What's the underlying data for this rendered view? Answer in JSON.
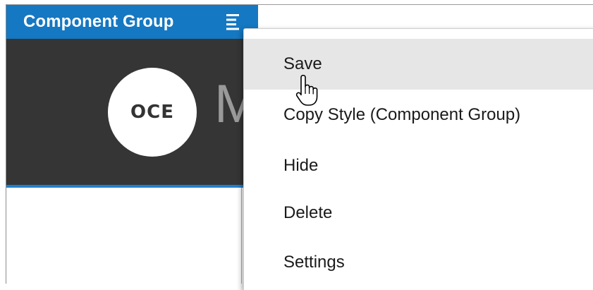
{
  "group": {
    "title": "Component Group",
    "accent_color": "#1578c2",
    "menu_icon": "hamburger-menu-icon"
  },
  "banner": {
    "background": "#353535",
    "logo_text": "OCE",
    "title_peek": "M"
  },
  "context_menu": {
    "items": [
      {
        "label": "Save",
        "hovered": true
      },
      {
        "label": "Copy Style (Component Group)",
        "hovered": false
      },
      {
        "label": "Hide",
        "hovered": false
      },
      {
        "label": "Delete",
        "hovered": false
      },
      {
        "label": "Settings",
        "hovered": false
      }
    ]
  },
  "cursor": {
    "icon": "hand-pointer-cursor-icon"
  }
}
